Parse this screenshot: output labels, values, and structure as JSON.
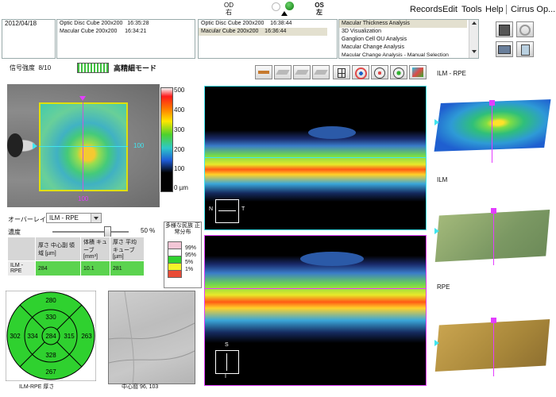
{
  "menu": {
    "items": [
      "Records",
      "Edit",
      "Tools",
      "Help",
      "Cirrus Op..."
    ]
  },
  "eye": {
    "od": "OD",
    "od_sub": "右",
    "os": "OS",
    "os_sub": "左"
  },
  "exam": {
    "date": "2012/04/18"
  },
  "scans_left": [
    {
      "name": "Optic Disc Cube 200x200",
      "time": "16:35:28"
    },
    {
      "name": "Macular Cube 200x200",
      "time": "16:34:21"
    }
  ],
  "scans_right": [
    {
      "name": "Optic Disc Cube 200x200",
      "time": "16:38:44"
    },
    {
      "name": "Macular Cube 200x200",
      "time": "16:36:44"
    }
  ],
  "analyses": [
    "Macular Thickness Analysis",
    "3D Visualization",
    "Ganglion Cell OU Analysis",
    "Macular Change Analysis",
    "Macular Change Analysis - Manual Selection"
  ],
  "signal": {
    "label": "信号強度",
    "value": "8/10"
  },
  "hd_mode": {
    "label": "高精細モード"
  },
  "color_scale": {
    "ticks": [
      "500",
      "400",
      "300",
      "200",
      "100",
      "0 µm"
    ]
  },
  "fundus": {
    "right_marker": "100",
    "bottom_marker": "100"
  },
  "overlay": {
    "label": "オーバーレイ",
    "value": "ILM - RPE"
  },
  "density": {
    "label": "濃度",
    "value": "50 %"
  },
  "norms": {
    "title": "多様な民族 正常分布",
    "items": [
      "99%",
      "95%",
      "5%",
      "1%"
    ],
    "colors": [
      "#f2c6d6",
      "#ffffff",
      "#2fd12f",
      "#f4f42a",
      "#e94b36"
    ]
  },
  "thickness_table": {
    "headers": [
      "厚さ 中心副 領域 [µm]",
      "体積 キューブ [mm³]",
      "厚さ 平均 キューブ [µm]"
    ],
    "row_label": "ILM - RPE",
    "values": [
      "284",
      "10.1",
      "281"
    ]
  },
  "etdrs": {
    "values": {
      "outer_top": "280",
      "inner_top": "330",
      "outer_left": "302",
      "inner_left": "334",
      "center": "284",
      "inner_right": "315",
      "outer_right": "263",
      "inner_bottom": "328",
      "outer_bottom": "267"
    },
    "caption": "ILM-RPE 厚さ"
  },
  "fovea": {
    "caption": "中心窩 96, 103"
  },
  "oct": {
    "upper_n": "N",
    "upper_t": "T",
    "lower_s": "S",
    "lower_i": "I"
  },
  "surfaces": {
    "ilm_rpe": "ILM - RPE",
    "ilm": "ILM",
    "rpe": "RPE"
  }
}
